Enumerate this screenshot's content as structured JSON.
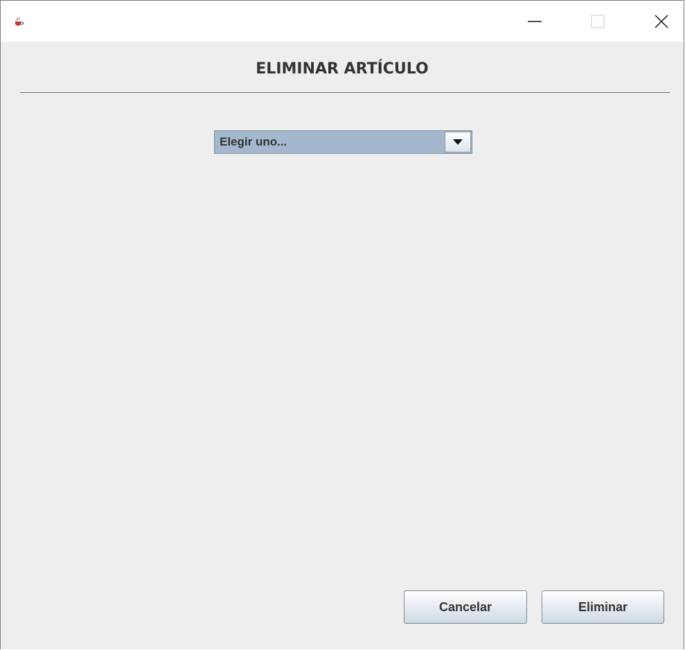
{
  "window": {
    "title": "",
    "app_icon": "java-coffee-cup-icon",
    "controls": {
      "minimize": "minimize-icon",
      "maximize": "maximize-icon",
      "close": "close-icon"
    }
  },
  "header": {
    "title": "ELIMINAR ARTÍCULO"
  },
  "selector": {
    "selected": "Elegir uno...",
    "icon": "chevron-down-icon"
  },
  "buttons": {
    "cancel_label": "Cancelar",
    "delete_label": "Eliminar"
  },
  "colors": {
    "content_bg": "#eeeeee",
    "combo_bg": "#a3b8cc",
    "text": "#333333"
  }
}
